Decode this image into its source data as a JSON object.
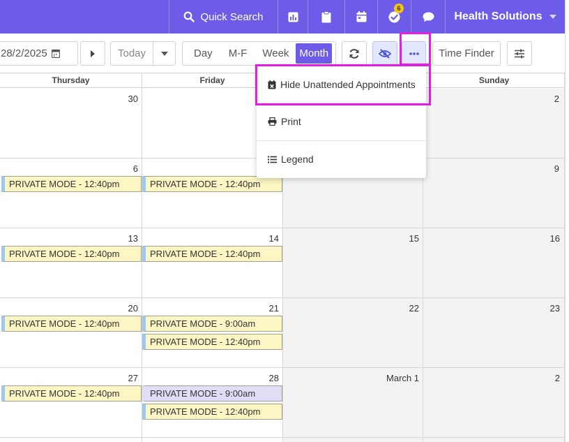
{
  "topbar": {
    "quick_search": "Quick Search",
    "notification_count": "6",
    "org_name": "Health Solutions"
  },
  "toolbar": {
    "date_value": "28/2/2025",
    "today": "Today",
    "views": [
      "Day",
      "M-F",
      "Week",
      "Month"
    ],
    "active_view": "Month",
    "time_finder": "Time Finder"
  },
  "calendar": {
    "headers": [
      "Thursday",
      "Friday",
      "",
      "Sunday"
    ],
    "cells": {
      "r0": [
        "30",
        "",
        "",
        "2"
      ],
      "r1": [
        "6",
        "",
        "",
        "9"
      ],
      "r2": [
        "13",
        "14",
        "15",
        "16"
      ],
      "r3": [
        "20",
        "21",
        "22",
        "23"
      ],
      "r4": [
        "27",
        "28",
        "March 1",
        "2"
      ]
    },
    "appointments": {
      "r1_thu": "PRIVATE MODE - 12:40pm",
      "r1_fri": "PRIVATE MODE - 12:40pm",
      "r2_thu": "PRIVATE MODE - 12:40pm",
      "r2_fri": "PRIVATE MODE - 12:40pm",
      "r3_thu": "PRIVATE MODE - 12:40pm",
      "r3_fri_a": "PRIVATE MODE - 9:00am",
      "r3_fri_b": "PRIVATE MODE - 12:40pm",
      "r4_thu": "PRIVATE MODE - 12:40pm",
      "r4_fri_a": "PRIVATE MODE - 9:00am",
      "r4_fri_b": "PRIVATE MODE - 12:40pm"
    }
  },
  "menu": {
    "hide_unattended": "Hide Unattended Appointments",
    "print": "Print",
    "legend": "Legend"
  },
  "colors": {
    "accent": "#6c5ce7",
    "highlight": "#e21ee6",
    "appointment": "#fcf5c4",
    "appointment_alt": "#e2dcf7"
  }
}
